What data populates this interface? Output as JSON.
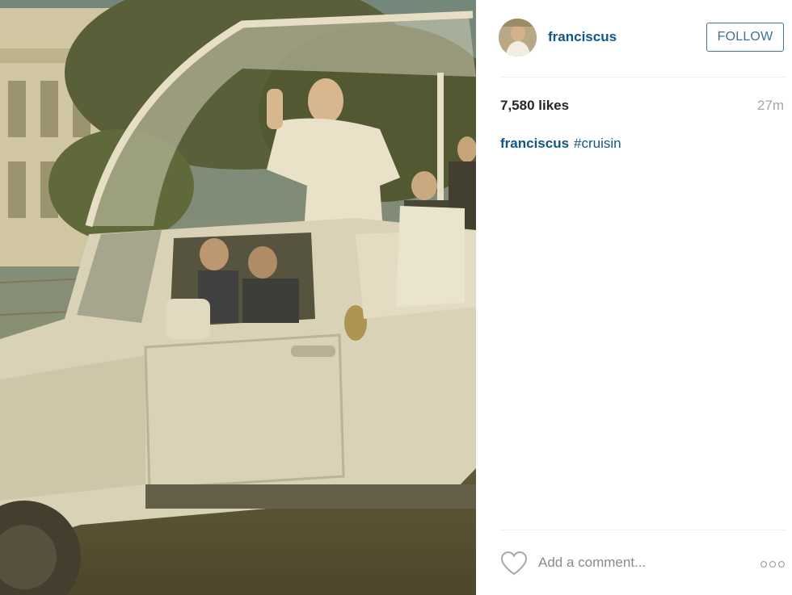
{
  "photo": {
    "alt": ""
  },
  "header": {
    "username": "franciscus",
    "follow_label": "FOLLOW"
  },
  "post": {
    "likes": "7,580 likes",
    "time": "27m",
    "caption_user": "franciscus",
    "caption_text": "#cruisin"
  },
  "comment": {
    "placeholder": "Add a comment...",
    "heart_icon": "heart-icon",
    "more_icon": "more-options-icon"
  },
  "colors": {
    "link": "#125688",
    "follow_border": "#3f729b",
    "muted": "#a5a7aa"
  }
}
